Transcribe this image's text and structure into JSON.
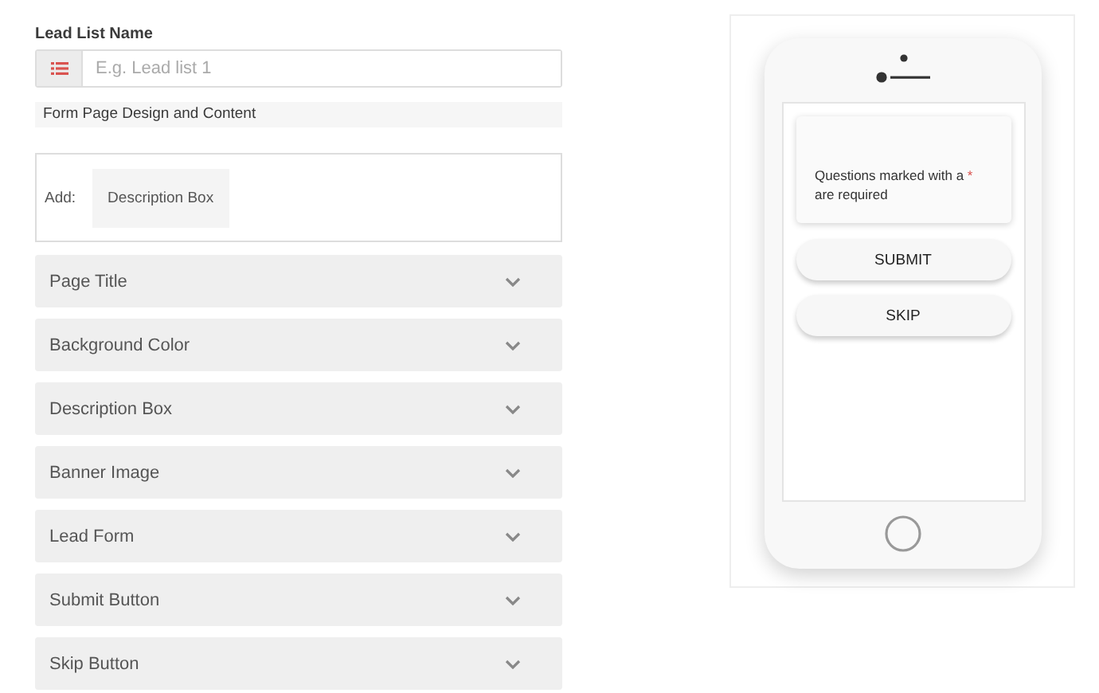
{
  "lead_list_name": {
    "label": "Lead List Name",
    "placeholder": "E.g. Lead list 1"
  },
  "section_title": "Form Page Design and Content",
  "add_box": {
    "label": "Add:",
    "options": [
      "Description Box"
    ]
  },
  "accordion": [
    {
      "label": "Page Title",
      "expanded": false
    },
    {
      "label": "Background Color",
      "expanded": false
    },
    {
      "label": "Description Box",
      "expanded": false
    },
    {
      "label": "Banner Image",
      "expanded": false
    },
    {
      "label": "Lead Form",
      "expanded": false
    },
    {
      "label": "Submit Button",
      "expanded": false
    },
    {
      "label": "Skip Button",
      "expanded": false
    }
  ],
  "preview": {
    "description": "Questions marked with a",
    "required_mark": "*",
    "description_end": "are required",
    "buttons": [
      "SUBMIT",
      "SKIP"
    ]
  }
}
